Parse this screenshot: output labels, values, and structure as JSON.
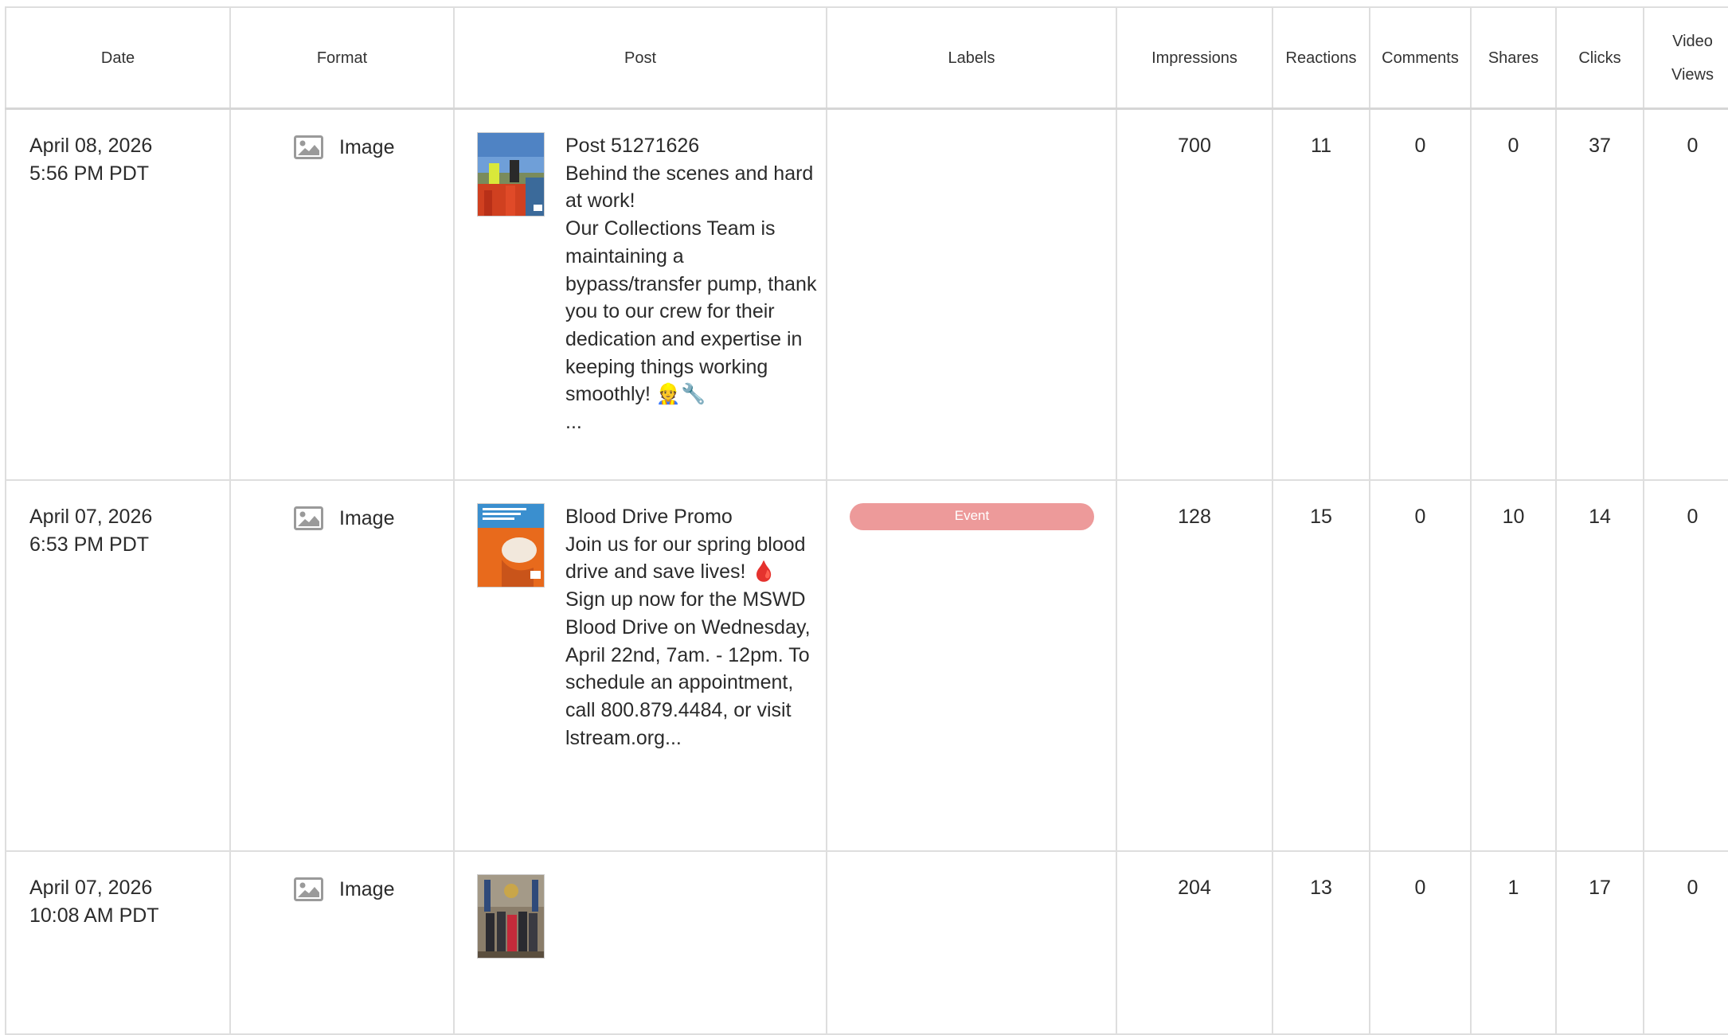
{
  "columns": {
    "date": "Date",
    "format": "Format",
    "post": "Post",
    "labels": "Labels",
    "impressions": "Impressions",
    "reactions": "Reactions",
    "comments": "Comments",
    "shares": "Shares",
    "clicks": "Clicks",
    "video_views_1": "Video",
    "video_views_2": "Views"
  },
  "rows": [
    {
      "date": "April 08, 2026",
      "time": "5:56 PM PDT",
      "format": "Image",
      "format_icon": "image-icon",
      "post_text": "Post 51271626\nBehind the scenes and hard at work!\nOur Collections Team is maintaining a bypass/transfer pump, thank you to our crew for their dedication and expertise in keeping things working smoothly! 👷🔧\n...",
      "label": "",
      "impressions": "700",
      "reactions": "11",
      "comments": "0",
      "shares": "0",
      "clicks": "37",
      "video_views": "0"
    },
    {
      "date": "April 07, 2026",
      "time": "6:53 PM PDT",
      "format": "Image",
      "format_icon": "image-icon",
      "post_text": "Blood Drive Promo\nJoin us for our spring blood drive and save lives! 🩸\nSign up now for the MSWD Blood Drive on Wednesday, April 22nd, 7am. - 12pm. To schedule an appointment, call 800.879.4484, or visit lstream.org...",
      "label": "Event",
      "label_color": "#ed9a9a",
      "impressions": "128",
      "reactions": "15",
      "comments": "0",
      "shares": "10",
      "clicks": "14",
      "video_views": "0"
    },
    {
      "date": "April 07, 2026",
      "time": "10:08 AM PDT",
      "format": "Image",
      "format_icon": "image-icon",
      "post_text": "",
      "label": "",
      "impressions": "204",
      "reactions": "13",
      "comments": "0",
      "shares": "1",
      "clicks": "17",
      "video_views": "0"
    }
  ]
}
